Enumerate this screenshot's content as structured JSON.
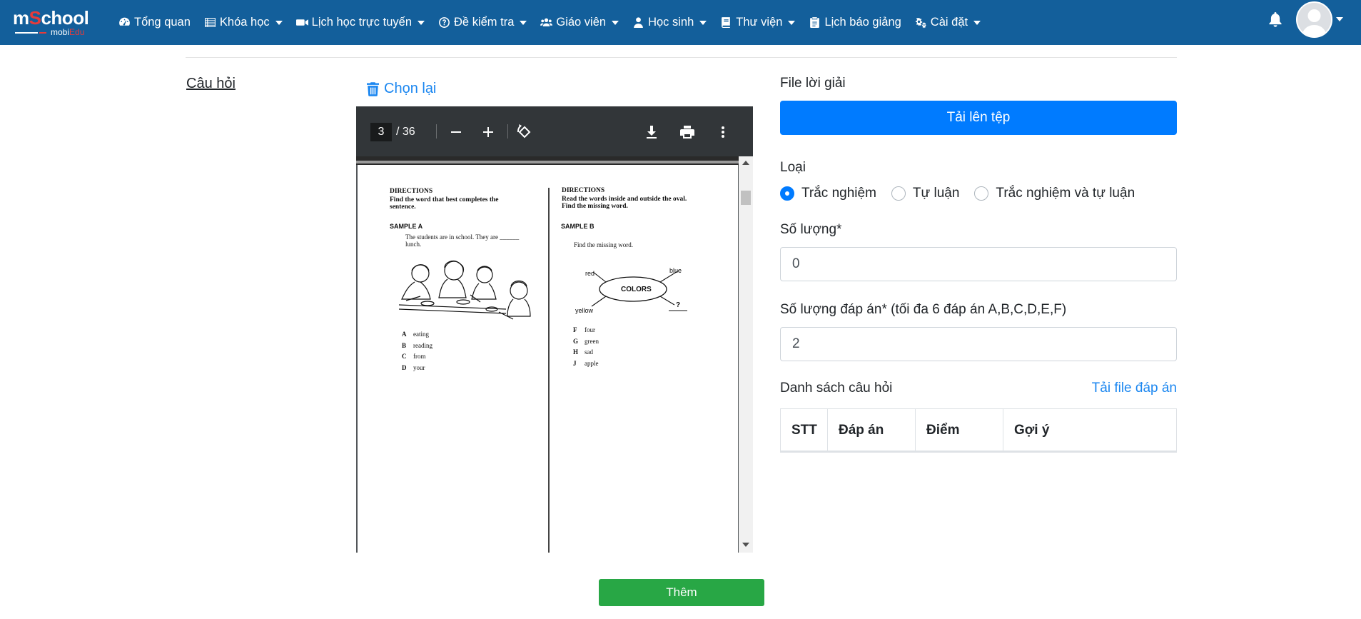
{
  "brand": {
    "logo_prefix": "m",
    "logo_accent": "S",
    "logo_suffix": "chool",
    "sub_prefix": "mobi",
    "sub_accent": "Edu",
    "primary_color": "#135f9b",
    "accent_color": "#e63b3b"
  },
  "nav": {
    "items": [
      {
        "label": "Tổng quan",
        "icon": "dashboard-icon",
        "dropdown": false
      },
      {
        "label": "Khóa học",
        "icon": "list-icon",
        "dropdown": true
      },
      {
        "label": "Lịch học trực tuyến",
        "icon": "video-icon",
        "dropdown": true
      },
      {
        "label": "Đề kiểm tra",
        "icon": "question-circle-icon",
        "dropdown": true
      },
      {
        "label": "Giáo viên",
        "icon": "users-icon",
        "dropdown": true
      },
      {
        "label": "Học sinh",
        "icon": "user-icon",
        "dropdown": true
      },
      {
        "label": "Thư viện",
        "icon": "book-icon",
        "dropdown": true
      },
      {
        "label": "Lịch báo giảng",
        "icon": "clipboard-icon",
        "dropdown": false
      },
      {
        "label": "Cài đặt",
        "icon": "gears-icon",
        "dropdown": true
      }
    ]
  },
  "section": {
    "question_label": "Câu hỏi",
    "reselect_label": "Chọn lại"
  },
  "pdf": {
    "current_page": "3",
    "total_pages": "/ 36",
    "doc": {
      "left_heading": "DIRECTIONS",
      "left_instruction_1": "Find the word that best completes the",
      "left_instruction_2": "sentence.",
      "left_sample": "SAMPLE A",
      "left_sentence_1": "The students are in school. They are ______",
      "left_sentence_2": "lunch.",
      "left_options": [
        {
          "letter": "A",
          "text": "eating"
        },
        {
          "letter": "B",
          "text": "reading"
        },
        {
          "letter": "C",
          "text": "from"
        },
        {
          "letter": "D",
          "text": "your"
        }
      ],
      "right_heading": "DIRECTIONS",
      "right_instruction_1": "Read the words inside and outside the oval.",
      "right_instruction_2": "Find the missing word.",
      "right_sample": "SAMPLE B",
      "right_prompt": "Find the missing word.",
      "web_center": "COLORS",
      "web_red": "red",
      "web_blue": "blue",
      "web_yellow": "yellow",
      "web_missing": "?",
      "right_options": [
        {
          "letter": "F",
          "text": "four"
        },
        {
          "letter": "G",
          "text": "green"
        },
        {
          "letter": "H",
          "text": "sad"
        },
        {
          "letter": "J",
          "text": "apple"
        }
      ]
    }
  },
  "form": {
    "solution_file_label": "File lời giải",
    "upload_button": "Tải lên tệp",
    "type_label": "Loại",
    "type_options": [
      {
        "label": "Trắc nghiệm",
        "checked": true
      },
      {
        "label": "Tự luận",
        "checked": false
      },
      {
        "label": "Trắc nghiệm và tự luận",
        "checked": false
      }
    ],
    "quantity_label": "Số lượng*",
    "quantity_value": "0",
    "answer_count_label": "Số lượng đáp án* (tối đa 6 đáp án A,B,C,D,E,F)",
    "answer_count_value": "2",
    "question_list_label": "Danh sách câu hỏi",
    "download_answer_link": "Tải file đáp án",
    "table_headers": [
      "STT",
      "Đáp án",
      "Điểm",
      "Gợi ý"
    ],
    "add_button": "Thêm",
    "upload_color": "#007bff",
    "add_color": "#28a745"
  }
}
